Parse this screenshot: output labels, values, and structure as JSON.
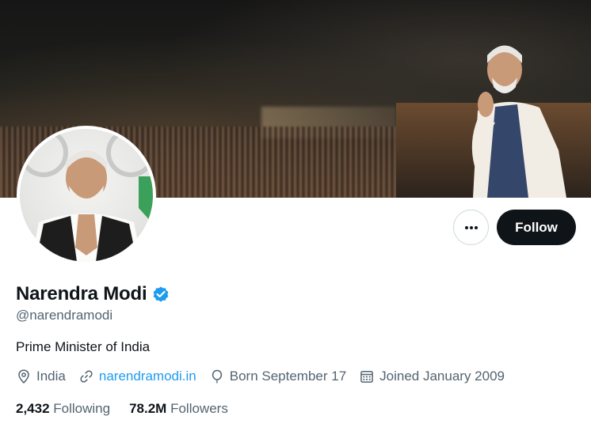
{
  "profile": {
    "name": "Narendra Modi",
    "handle": "@narendramodi",
    "bio": "Prime Minister of India",
    "verified_color": "#1d9bf0"
  },
  "actions": {
    "follow_label": "Follow",
    "more_icon": "more-horizontal-icon"
  },
  "meta": {
    "location": "India",
    "website": "narendramodi.in",
    "birthday": "Born September 17",
    "joined": "Joined January 2009"
  },
  "stats": {
    "following_count": "2,432",
    "following_label": "Following",
    "followers_count": "78.2M",
    "followers_label": "Followers"
  },
  "colors": {
    "accent": "#1d9bf0",
    "text_primary": "#0f1419",
    "text_secondary": "#536471",
    "button_dark": "#0f1419"
  }
}
